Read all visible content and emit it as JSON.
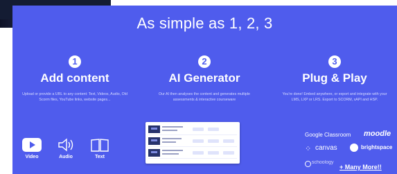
{
  "heading": "As simple as 1, 2, 3",
  "steps": [
    {
      "number": "1",
      "title": "Add content",
      "description": "Upload or provide a URL to any content: Text, Videos, Audio, Old Scorm files, YouTube links, website pages..."
    },
    {
      "number": "2",
      "title": "AI Generator",
      "description": "Our AI then analyses the content and generates multiple assessments & interactive courseware"
    },
    {
      "number": "3",
      "title": "Plug & Play",
      "description": "You're done! Embed anywhere, or export and integrate with your LMS, LXP or LRS. Export to SCORM, xAPI and HSP."
    }
  ],
  "formats": [
    {
      "label": "Video",
      "icon": "play-icon"
    },
    {
      "label": "Audio",
      "icon": "speaker-icon"
    },
    {
      "label": "Text",
      "icon": "book-icon"
    }
  ],
  "integrations": {
    "google_classroom": "Google Classroom",
    "moodle": "moodle",
    "canvas": "canvas",
    "brightspace": "brightspace",
    "schoology": "schoology",
    "more": "+ Many More!!"
  },
  "colors": {
    "background": "#4f5ced",
    "text": "#ffffff",
    "accent_dark": "#26326c"
  }
}
